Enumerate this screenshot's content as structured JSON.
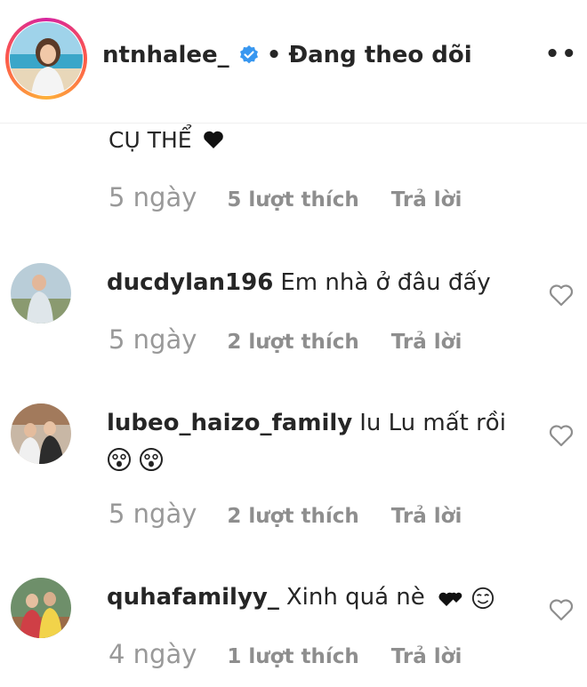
{
  "header": {
    "username": "ntnhalee_",
    "separator": "•",
    "following_label": "Đang theo dõi",
    "more_label": "••"
  },
  "caption": {
    "text": "CỤ THỂ",
    "time": "5 ngày",
    "likes": "5 lượt thích",
    "reply": "Trả lời"
  },
  "comments": [
    {
      "username": "ducdylan196",
      "text": "Em nhà ở đâu đấy",
      "time": "5 ngày",
      "likes": "2 lượt thích",
      "reply": "Trả lời"
    },
    {
      "username": "lubeo_haizo_family",
      "text": "Iu Lu mất rồi",
      "time": "5 ngày",
      "likes": "2 lượt thích",
      "reply": "Trả lời"
    },
    {
      "username": "quhafamilyy_",
      "text": "Xinh quá nè",
      "time": "4 ngày",
      "likes": "1 lượt thích",
      "reply": "Trả lời"
    }
  ],
  "colors": {
    "verified": "#3897f0",
    "secondary_text": "#8e8e8e",
    "primary_text": "#262626"
  },
  "icons": [
    "verified-badge-icon",
    "heart-icon",
    "like-heart-icon",
    "astonished-face-emoji",
    "two-hearts-emoji",
    "smiling-face-emoji"
  ]
}
